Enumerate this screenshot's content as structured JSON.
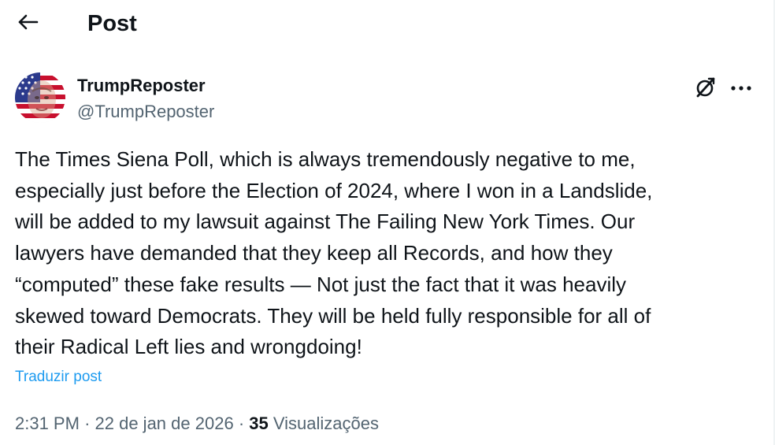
{
  "header": {
    "back_icon": "arrow-left-icon",
    "title": "Post"
  },
  "author": {
    "display_name": "TrumpReposter",
    "handle": "@TrumpReposter",
    "avatar_icon": "american-flag-face-avatar"
  },
  "actions": {
    "grok_icon": "grok-slash-icon",
    "more_icon": "more-horizontal-icon"
  },
  "post": {
    "text": "The Times Siena Poll, which is always tremendously negative to me,\nespecially just before the Election of 2024, where I won in a Landslide,\nwill be added to my lawsuit against The Failing New York Times. Our\nlawyers have demanded that they keep all Records, and how they\n“computed” these fake results — Not just the fact that it was heavily\nskewed toward Democrats. They will be held fully responsible for all of\ntheir Radical Left lies and wrongdoing!",
    "translate_label": "Traduzir post"
  },
  "meta": {
    "time": "2:31 PM",
    "separator": "·",
    "date": "22 de jan de 2026",
    "views_count": "35",
    "views_label": "Visualizações"
  },
  "colors": {
    "text_primary": "#0f1419",
    "text_secondary": "#536471",
    "link": "#1d9bf0"
  }
}
